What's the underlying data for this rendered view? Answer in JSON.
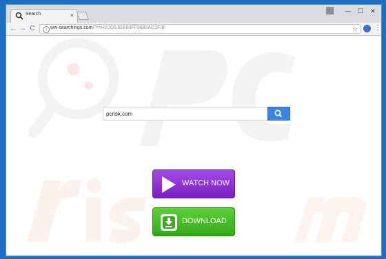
{
  "tab": {
    "title": "Search",
    "close": "×"
  },
  "window_controls": {
    "minimize": "—",
    "maximize": "☐",
    "close": "✕"
  },
  "toolbar": {
    "back": "←",
    "forward": "→",
    "reload": "C",
    "menu": "⋮",
    "star": "☆",
    "info": "i"
  },
  "address": {
    "host": "ww-searchings.com",
    "path": "/?r=HXJD5JGE00FF9682AC1F3F"
  },
  "search": {
    "value": "pcrisk.com",
    "icon": "search-icon"
  },
  "buttons": {
    "watch": "WATCH NOW",
    "download": "DOWNLOAD"
  },
  "colors": {
    "frame": "#1d6fc4",
    "search_button": "#3c83e3",
    "watch": "#8b2fd0",
    "download": "#45bb25"
  }
}
